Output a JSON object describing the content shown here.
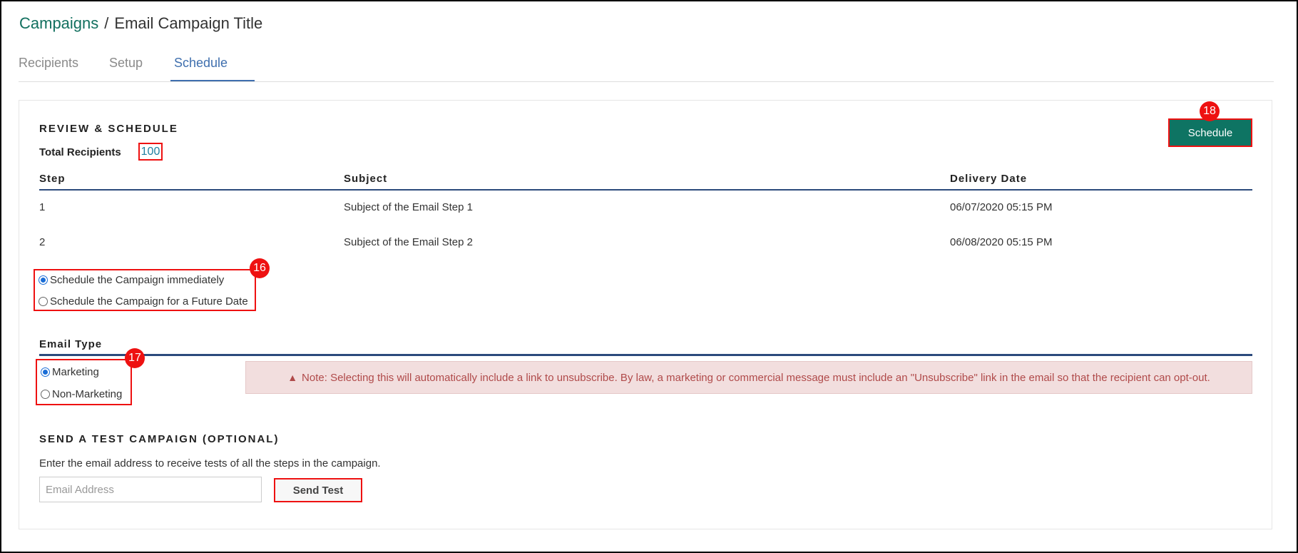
{
  "breadcrumb": {
    "parent": "Campaigns",
    "separator": "/",
    "current": "Email Campaign Title"
  },
  "tabs": [
    {
      "label": "Recipients",
      "active": false
    },
    {
      "label": "Setup",
      "active": false
    },
    {
      "label": "Schedule",
      "active": true
    }
  ],
  "review": {
    "title": "REVIEW & SCHEDULE",
    "total_recipients_label": "Total Recipients",
    "total_recipients_value": "100",
    "schedule_button": "Schedule",
    "badge_schedule": "18"
  },
  "steps_table": {
    "headers": [
      "Step",
      "Subject",
      "Delivery Date"
    ],
    "rows": [
      [
        "1",
        "Subject of the Email Step 1",
        "06/07/2020 05:15 PM"
      ],
      [
        "2",
        "Subject of the Email Step 2",
        "06/08/2020 05:15 PM"
      ]
    ]
  },
  "schedule_options": {
    "badge": "16",
    "options": [
      {
        "label": "Schedule the Campaign immediately",
        "checked": true
      },
      {
        "label": "Schedule the Campaign for a Future Date",
        "checked": false
      }
    ]
  },
  "email_type": {
    "title": "Email Type",
    "badge": "17",
    "options": [
      {
        "label": "Marketing",
        "checked": true
      },
      {
        "label": "Non-Marketing",
        "checked": false
      }
    ],
    "note_icon": "warning-icon",
    "note": "Note: Selecting this will automatically include a link to unsubscribe. By law, a marketing or commercial message must include an \"Unsubscribe\" link in the email so that the recipient can opt-out."
  },
  "test_campaign": {
    "title": "SEND A TEST CAMPAIGN (OPTIONAL)",
    "description": "Enter the email address to receive tests of all the steps in the campaign.",
    "email_placeholder": "Email Address",
    "email_value": "",
    "send_button": "Send Test"
  },
  "colors": {
    "brand_green": "#0e7463",
    "link_blue": "#3f6fae",
    "annotation_red": "#ee1111",
    "note_bg": "#f2dede"
  }
}
